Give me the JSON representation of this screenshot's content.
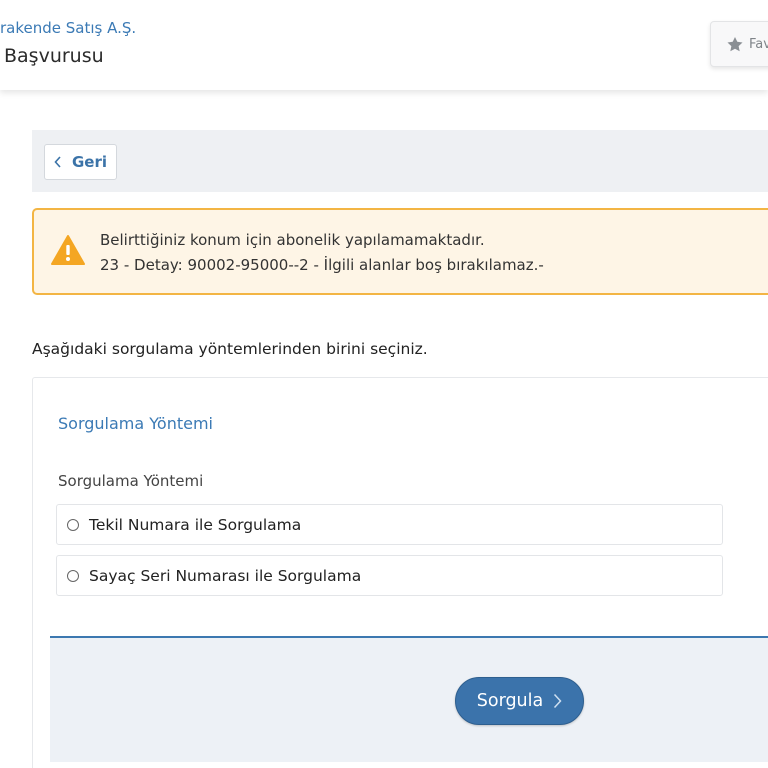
{
  "header": {
    "org_name": "rakende Satış A.Ş.",
    "page_title": "Başvurusu",
    "favorites_label": "Fav"
  },
  "toolbar": {
    "back_label": "Geri"
  },
  "alert": {
    "line1": "Belirttiğiniz konum için abonelik yapılamamaktadır.",
    "line2": "23 - Detay: 90002-95000--2 - İlgili alanlar boş bırakılamaz.-",
    "color": "#f3b544"
  },
  "instruction": "Aşağıdaki sorgulama yöntemlerinden birini seçiniz.",
  "form": {
    "section_title": "Sorgulama Yöntemi",
    "field_label": "Sorgulama Yöntemi",
    "options": [
      {
        "label": "Tekil Numara ile Sorgulama",
        "selected": false
      },
      {
        "label": "Sayaç Seri Numarası ile Sorgulama",
        "selected": false
      }
    ],
    "submit_label": "Sorgula"
  },
  "colors": {
    "accent": "#3b73ab",
    "warning": "#f3b544",
    "link": "#3b7ab5"
  },
  "icons": {
    "favorites": "star-icon",
    "back": "chevron-left-icon",
    "alert": "warning-triangle-icon",
    "submit": "chevron-right-icon"
  }
}
